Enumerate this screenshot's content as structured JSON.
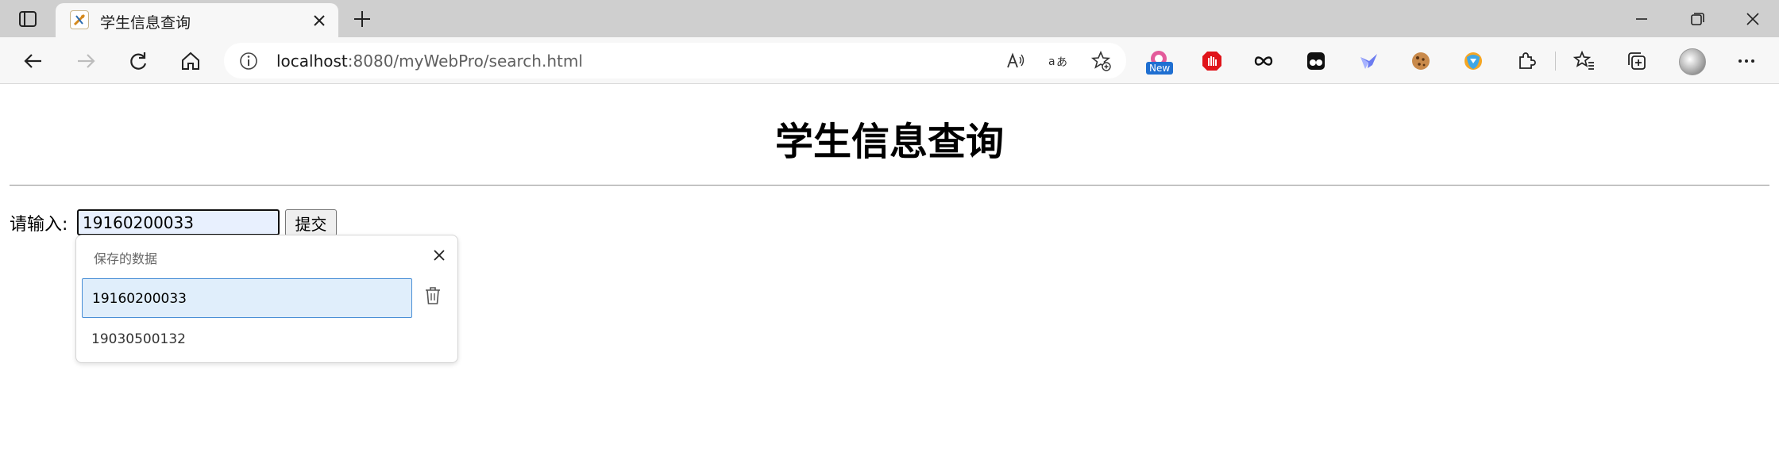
{
  "browser": {
    "tab": {
      "title": "学生信息查询",
      "favicon": "java-cup-favicon"
    },
    "address_bar": {
      "host": "localhost",
      "path": ":8080/myWebPro/search.html"
    },
    "extensions": {
      "new_badge": "New"
    },
    "icons": {
      "back": "back-arrow-icon",
      "forward": "forward-arrow-icon",
      "refresh": "refresh-icon",
      "home": "home-icon",
      "read_aloud": "read-aloud-icon",
      "translate": "translate-icon",
      "favorite": "add-favorite-icon",
      "favorites": "favorites-icon",
      "collections": "collections-icon",
      "more": "more-icon"
    }
  },
  "page": {
    "title": "学生信息查询",
    "label": "请输入:",
    "input_value": "19160200033",
    "submit_label": "提交"
  },
  "autofill": {
    "header": "保存的数据",
    "items": [
      "19160200033",
      "19030500132"
    ]
  },
  "colors": {
    "tabstrip": "#cfcfcf",
    "toolbar": "#f7f7f7",
    "autofill_selected": "#e0eefb",
    "input_autofilled": "#e8f0fe"
  }
}
